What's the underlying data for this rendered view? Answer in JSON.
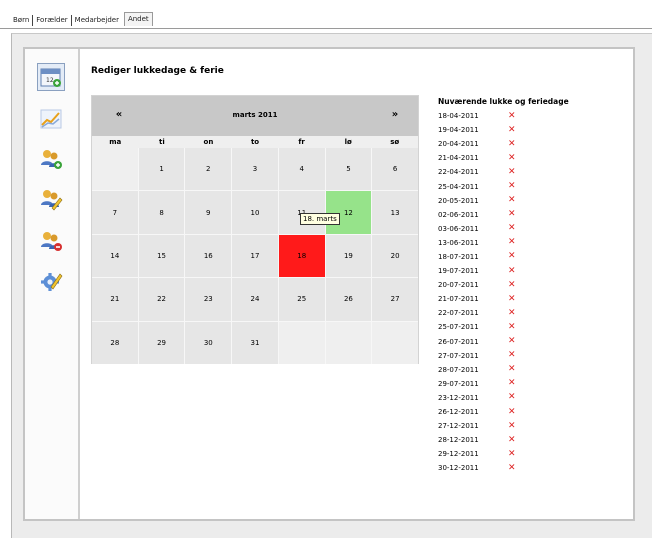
{
  "tabs": [
    "Børn",
    "Forælder",
    "Medarbejder",
    "Andet"
  ],
  "active_tab": "Andet",
  "sidebar": {
    "icons": [
      "calendar-add-icon",
      "chart-icon",
      "users-add-icon",
      "users-edit-icon",
      "users-remove-icon",
      "gear-edit-icon"
    ]
  },
  "page": {
    "heading": "Rediger lukkedage & ferie"
  },
  "calendar": {
    "prev_label": "«",
    "next_label": "»",
    "month_label": "marts 2011",
    "weekdays": [
      "ma",
      "ti",
      "on",
      "to",
      "fr",
      "lø",
      "sø"
    ],
    "days": [
      "1",
      "2",
      "3",
      "4",
      "5",
      "6",
      "7",
      "8",
      "9",
      "10",
      "11",
      "12",
      "13",
      "14",
      "15",
      "16",
      "17",
      "18",
      "19",
      "20",
      "21",
      "22",
      "23",
      "24",
      "25",
      "26",
      "27",
      "28",
      "29",
      "30",
      "31"
    ],
    "first_day_offset": 1,
    "today": "12",
    "selected": "18",
    "tooltip": "18. marts",
    "colors": {
      "today": "#96e38a",
      "selected": "#ff1a1a"
    }
  },
  "closed_days": {
    "title": "Nuværende lukke og feriedage",
    "dates": [
      "18-04-2011",
      "19-04-2011",
      "20-04-2011",
      "21-04-2011",
      "22-04-2011",
      "25-04-2011",
      "20-05-2011",
      "02-06-2011",
      "03-06-2011",
      "13-06-2011",
      "18-07-2011",
      "19-07-2011",
      "20-07-2011",
      "21-07-2011",
      "22-07-2011",
      "25-07-2011",
      "26-07-2011",
      "27-07-2011",
      "28-07-2011",
      "29-07-2011",
      "23-12-2011",
      "26-12-2011",
      "27-12-2011",
      "28-12-2011",
      "29-12-2011",
      "30-12-2011"
    ],
    "delete_glyph": "✕"
  }
}
